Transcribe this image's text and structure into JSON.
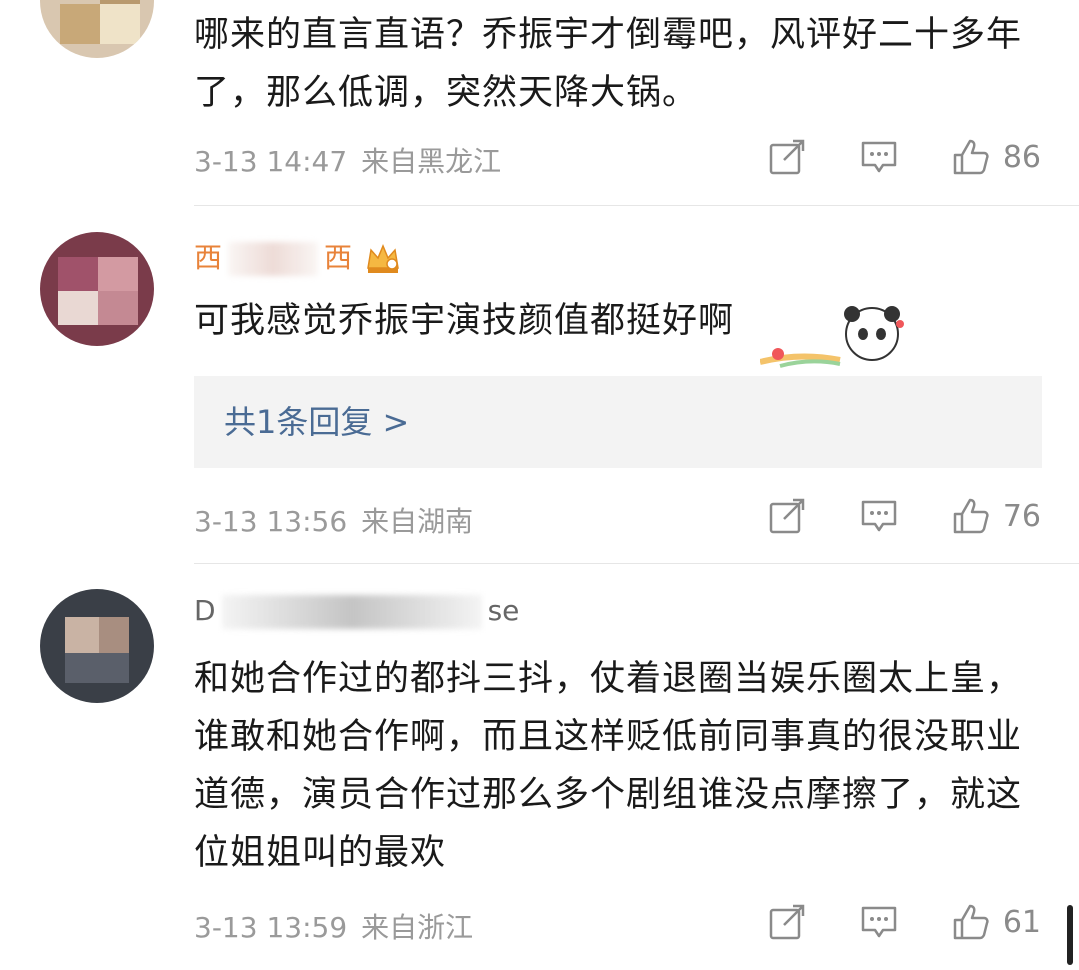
{
  "comments": [
    {
      "username": "",
      "text": "哪来的直言直语？乔振宇才倒霉吧，风评好二十多年了，那么低调，突然天降大锅。",
      "time": "3-13 14:47",
      "location": "来自黑龙江",
      "likes": "86",
      "reply_label": ""
    },
    {
      "username_start": "西",
      "username_end": "西",
      "text": "可我感觉乔振宇演技颜值都挺好啊",
      "time": "3-13 13:56",
      "location": "来自湖南",
      "likes": "76",
      "reply_label": "共1条回复 >"
    },
    {
      "username_start": "D",
      "username_end": "se",
      "text": "和她合作过的都抖三抖，仗着退圈当娱乐圈太上皇，谁敢和她合作啊，而且这样贬低前同事真的很没职业道德，演员合作过那么多个剧组谁没点摩擦了，就这位姐姐叫的最欢",
      "time": "3-13 13:59",
      "location": "来自浙江",
      "likes": "61",
      "reply_label": ""
    }
  ],
  "icons": {
    "repost": "repost-icon",
    "comment": "comment-icon",
    "like": "thumbs-up-icon",
    "badge": "crown-icon",
    "sticker": "panda-sticker"
  },
  "colors": {
    "username": "#e8833a",
    "meta": "#9a9a9a",
    "reply_link": "#4a6b94",
    "reply_bg": "#f3f3f3"
  }
}
